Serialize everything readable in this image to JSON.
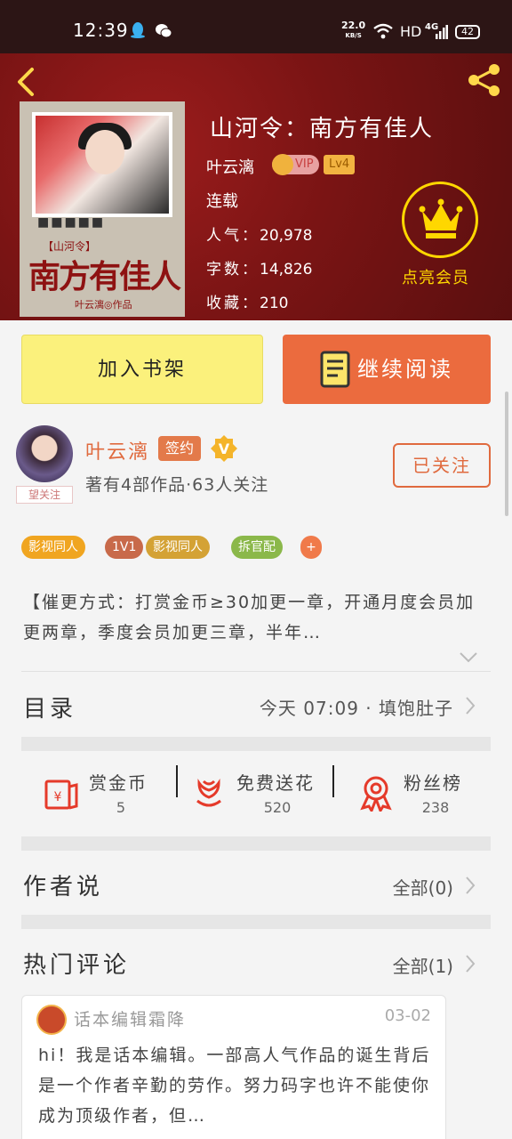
{
  "status_bar": {
    "time": "12:39",
    "speed_value": "22.0",
    "speed_unit": "KB/S",
    "hd": "HD",
    "network": "4G",
    "battery": "42"
  },
  "book": {
    "title": "山河令：南方有佳人",
    "author": "叶云漓",
    "vip_label": "VIP",
    "level": "Lv4",
    "status": "连载",
    "popularity_label": "人气：",
    "popularity": "20,978",
    "words_label": "字数：",
    "words": "14,826",
    "favorites_label": "收藏：",
    "favorites": "210",
    "vip_member_label": "点亮会员",
    "cover": {
      "tag": "【山河令】",
      "title": "南方有佳人",
      "author": "叶云漓◎作品",
      "dots": "■■■■■"
    }
  },
  "actions": {
    "add_shelf": "加入书架",
    "continue_read": "继续阅读"
  },
  "author_section": {
    "name": "叶云漓",
    "signed": "签约",
    "works": "著有4部作品·63人关注",
    "follow": "已关注",
    "avatar_tag": "望关注"
  },
  "tags": [
    {
      "label": "影视同人",
      "color": "#f0a520"
    },
    {
      "label": "1V1",
      "color": "#c86a4a"
    },
    {
      "label": "影视同人",
      "color": "#d4a235"
    },
    {
      "label": "拆官配",
      "color": "#8bb84a"
    }
  ],
  "tag_more": "+",
  "description": "【催更方式：打赏金币≥30加更一章，开通月度会员加更两章，季度会员加更三章，半年…",
  "toc": {
    "label": "目录",
    "update": "今天 07:09 · 填饱肚子"
  },
  "stats": [
    {
      "label": "赏金币",
      "value": "5"
    },
    {
      "label": "免费送花",
      "value": "520"
    },
    {
      "label": "粉丝榜",
      "value": "238"
    }
  ],
  "author_says": {
    "label": "作者说",
    "all": "全部(0)"
  },
  "hot_comments": {
    "label": "热门评论",
    "all": "全部(1)",
    "items": [
      {
        "user": "话本编辑霜降",
        "date": "03-02",
        "text": "hi！我是话本编辑。一部高人气作品的诞生背后是一个作者辛勤的劳作。努力码字也许不能使你成为顶级作者，但…"
      }
    ]
  },
  "colors": {
    "hero": "#7a1414",
    "accent": "#e06a3e",
    "gold": "#ffd700",
    "shelf_btn": "#fbf17c",
    "read_btn": "#eb6b3e"
  }
}
